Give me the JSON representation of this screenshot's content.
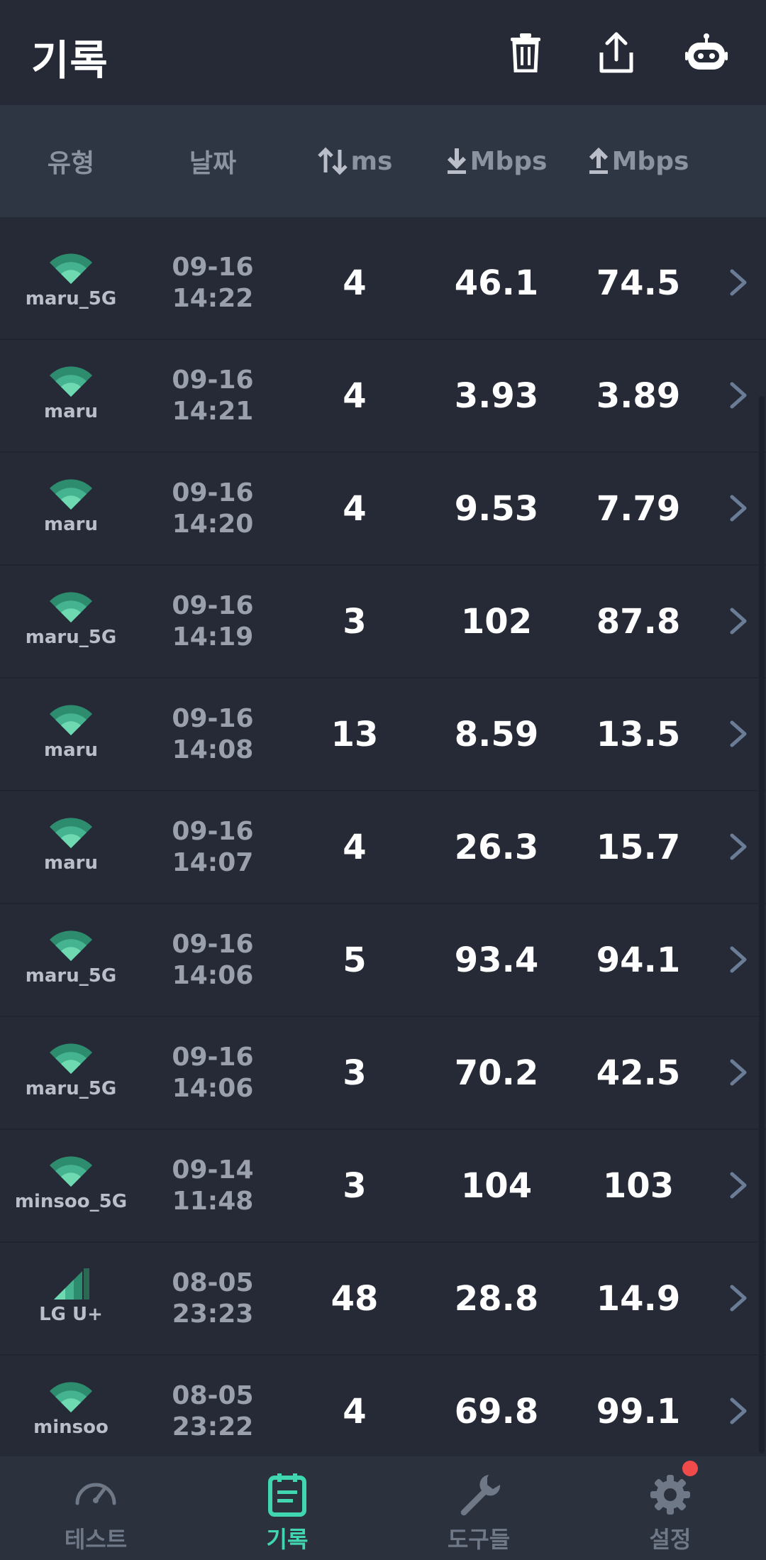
{
  "header": {
    "title": "기록",
    "icons": [
      "trash-icon",
      "share-icon",
      "robot-icon"
    ]
  },
  "columns": {
    "type": "유형",
    "date": "날짜",
    "ping": "ms",
    "download": "Mbps",
    "upload": "Mbps"
  },
  "records": [
    {
      "name": "maru_5G",
      "kind": "wifi",
      "date": "09-16",
      "time": "14:22",
      "ping": "4",
      "download": "46.1",
      "upload": "74.5"
    },
    {
      "name": "maru",
      "kind": "wifi",
      "date": "09-16",
      "time": "14:21",
      "ping": "4",
      "download": "3.93",
      "upload": "3.89"
    },
    {
      "name": "maru",
      "kind": "wifi",
      "date": "09-16",
      "time": "14:20",
      "ping": "4",
      "download": "9.53",
      "upload": "7.79"
    },
    {
      "name": "maru_5G",
      "kind": "wifi",
      "date": "09-16",
      "time": "14:19",
      "ping": "3",
      "download": "102",
      "upload": "87.8"
    },
    {
      "name": "maru",
      "kind": "wifi",
      "date": "09-16",
      "time": "14:08",
      "ping": "13",
      "download": "8.59",
      "upload": "13.5"
    },
    {
      "name": "maru",
      "kind": "wifi",
      "date": "09-16",
      "time": "14:07",
      "ping": "4",
      "download": "26.3",
      "upload": "15.7"
    },
    {
      "name": "maru_5G",
      "kind": "wifi",
      "date": "09-16",
      "time": "14:06",
      "ping": "5",
      "download": "93.4",
      "upload": "94.1"
    },
    {
      "name": "maru_5G",
      "kind": "wifi",
      "date": "09-16",
      "time": "14:06",
      "ping": "3",
      "download": "70.2",
      "upload": "42.5"
    },
    {
      "name": "minsoo_5G",
      "kind": "wifi",
      "date": "09-14",
      "time": "11:48",
      "ping": "3",
      "download": "104",
      "upload": "103"
    },
    {
      "name": "LG U+",
      "kind": "cellular",
      "date": "08-05",
      "time": "23:23",
      "ping": "48",
      "download": "28.8",
      "upload": "14.9"
    },
    {
      "name": "minsoo",
      "kind": "wifi",
      "date": "08-05",
      "time": "23:22",
      "ping": "4",
      "download": "69.8",
      "upload": "99.1"
    }
  ],
  "nav": [
    {
      "label": "테스트",
      "icon": "speedometer-icon",
      "active": false
    },
    {
      "label": "기록",
      "icon": "history-icon",
      "active": true
    },
    {
      "label": "도구들",
      "icon": "wrench-icon",
      "active": false
    },
    {
      "label": "설정",
      "icon": "gear-icon",
      "active": false,
      "badge": true
    }
  ],
  "colors": {
    "background": "#252a36",
    "header_row": "#2f3643",
    "accent": "#3fd6b0",
    "badge": "#f04a4a"
  }
}
